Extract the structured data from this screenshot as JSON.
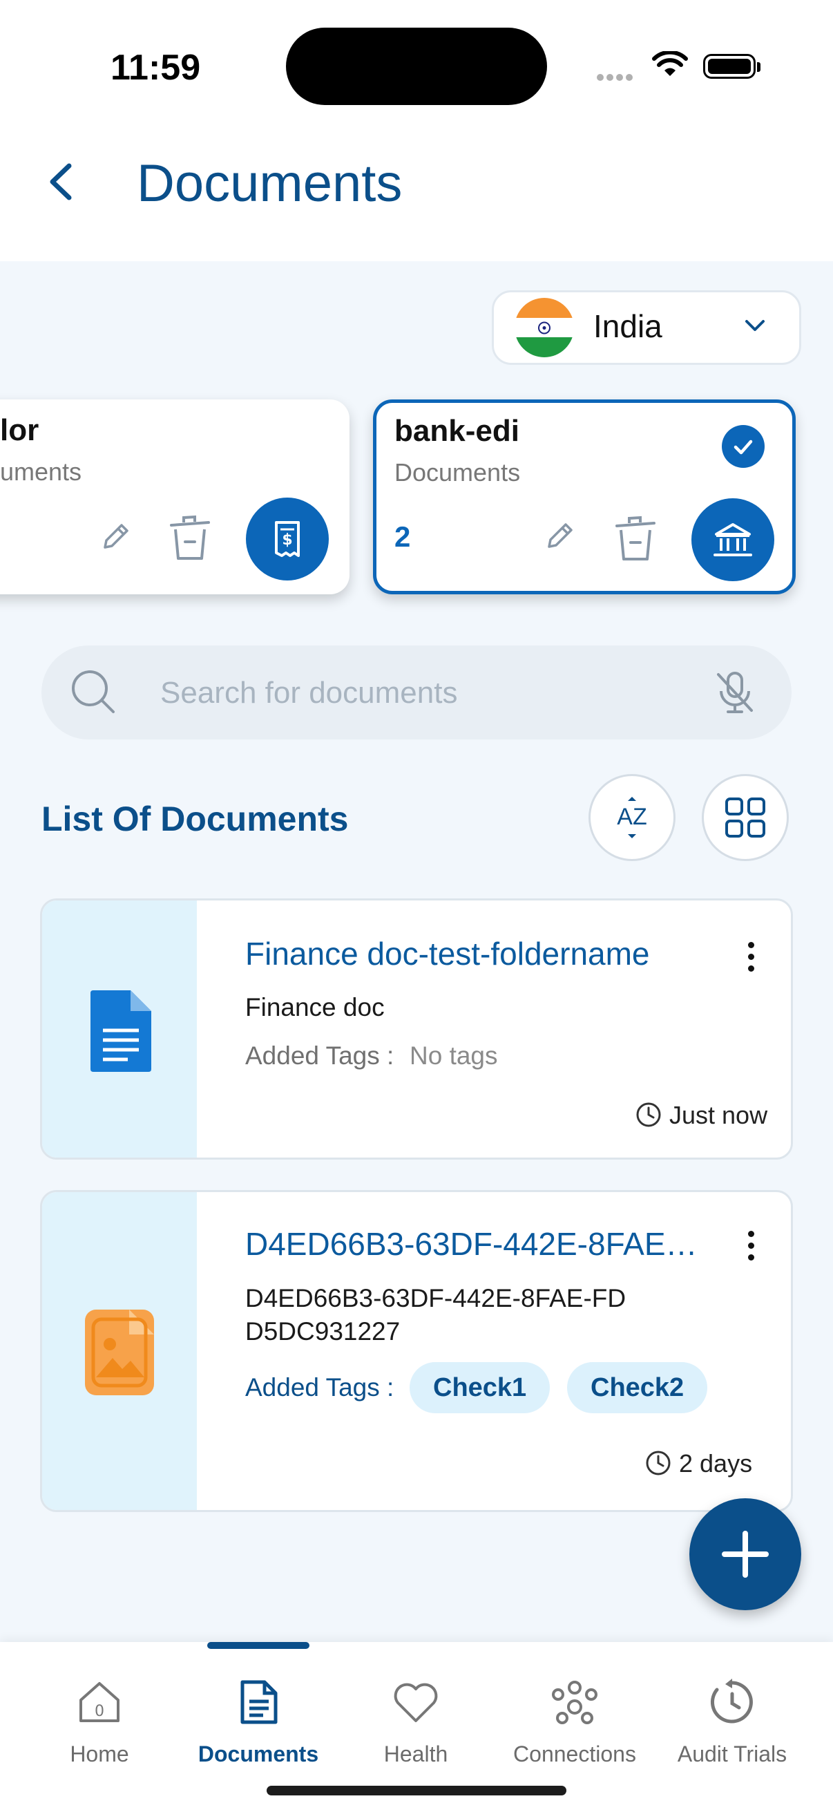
{
  "status_bar": {
    "time": "11:59"
  },
  "header": {
    "title": "Documents"
  },
  "country_selector": {
    "selected": "India"
  },
  "folders": [
    {
      "title": "lor",
      "subtitle": "uments"
    },
    {
      "title": "bank-edi",
      "subtitle": "Documents",
      "count": "2",
      "selected": true
    }
  ],
  "search": {
    "placeholder": "Search for documents"
  },
  "list": {
    "title": "List Of Documents"
  },
  "documents": [
    {
      "title": "Finance doc-test-foldername",
      "subtitle": "Finance doc",
      "tags_label": "Added Tags :",
      "tags_empty": "No tags",
      "time": "Just now",
      "icon": "google-doc-icon"
    },
    {
      "title": "D4ED66B3-63DF-442E-8FAE…",
      "subtitle": "D4ED66B3-63DF-442E-8FAE-FDD5DC931227",
      "tags_label": "Added Tags :",
      "tags": [
        "Check1",
        "Check2"
      ],
      "time": "2 days",
      "icon": "image-file-icon"
    }
  ],
  "bottom_nav": [
    {
      "label": "Home",
      "icon": "home-icon"
    },
    {
      "label": "Documents",
      "icon": "document-icon",
      "active": true
    },
    {
      "label": "Health",
      "icon": "heart-icon"
    },
    {
      "label": "Connections",
      "icon": "connections-icon"
    },
    {
      "label": "Audit Trials",
      "icon": "audit-icon"
    }
  ],
  "colors": {
    "primary": "#0b4f8a",
    "accent": "#0c66b8",
    "background": "#f2f7fc"
  }
}
